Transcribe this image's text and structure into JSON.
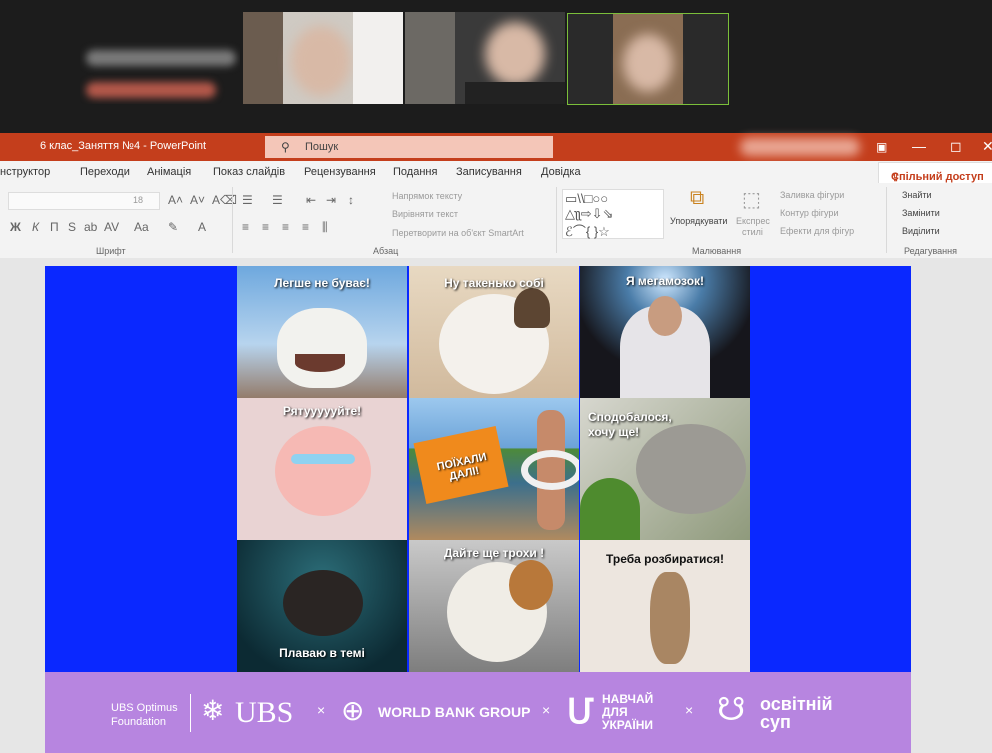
{
  "window": {
    "doc_title": "6 клас_Заняття №4 - PowerPoint",
    "search_placeholder": "Пошук",
    "share_label": "Спільний доступ"
  },
  "tabs": [
    {
      "label": "нструктор"
    },
    {
      "label": "Переходи"
    },
    {
      "label": "Анімація"
    },
    {
      "label": "Показ слайдів"
    },
    {
      "label": "Рецензування"
    },
    {
      "label": "Подання"
    },
    {
      "label": "Записування"
    },
    {
      "label": "Довідка"
    }
  ],
  "ribbon": {
    "font_size": "18",
    "text_direction": "Напрямок тексту",
    "align_text": "Вирівняти текст",
    "convert_smartart": "Перетворити на об'єкт SmartArt",
    "arrange": "Упорядкувати",
    "quick_styles_1": "Експрес",
    "quick_styles_2": "стилі",
    "shape_fill": "Заливка фігури",
    "shape_outline": "Контур фігури",
    "shape_effects": "Ефекти для фігур",
    "find": "Знайти",
    "replace": "Замінити",
    "select": "Виділити",
    "groups": {
      "font": "Шрифт",
      "paragraph": "Абзац",
      "drawing": "Малювання",
      "editing": "Редагування"
    }
  },
  "slide": {
    "memes": [
      {
        "caption": "Легше не буває!",
        "subject": "goat"
      },
      {
        "caption": "Ну такенько собі",
        "subject": "cat"
      },
      {
        "caption": "Я мегамозок!",
        "subject": "man-glow"
      },
      {
        "caption": "Рятуууууйте!",
        "subject": "crying-cat-cartoon"
      },
      {
        "caption": "ПОЇХАЛИ ДАЛІ!",
        "subject": "man-with-float"
      },
      {
        "caption": "Сподобалося, хочу ще!",
        "subject": "cat-eating-grass"
      },
      {
        "caption": "Плаваю в темі",
        "subject": "dog-underwater"
      },
      {
        "caption": "Дайте ще трохи !",
        "subject": "cat-closeup"
      },
      {
        "caption": "Треба розбиратися!",
        "subject": "squirrel"
      }
    ],
    "footer": {
      "ubs_optimus_1": "UBS Optimus",
      "ubs_optimus_2": "Foundation",
      "ubs": "UBS",
      "world_bank": "WORLD BANK GROUP",
      "navchai_1": "НАВЧАЙ",
      "navchai_2": "ДЛЯ",
      "navchai_3": "УКРАЇНИ",
      "osvitniy_1": "освітній",
      "osvitniy_2": "суп",
      "x": "×"
    }
  },
  "colors": {
    "ppt_red": "#c43e1c",
    "slide_blue": "#0a28ff",
    "footer_purple": "#b785e0"
  }
}
